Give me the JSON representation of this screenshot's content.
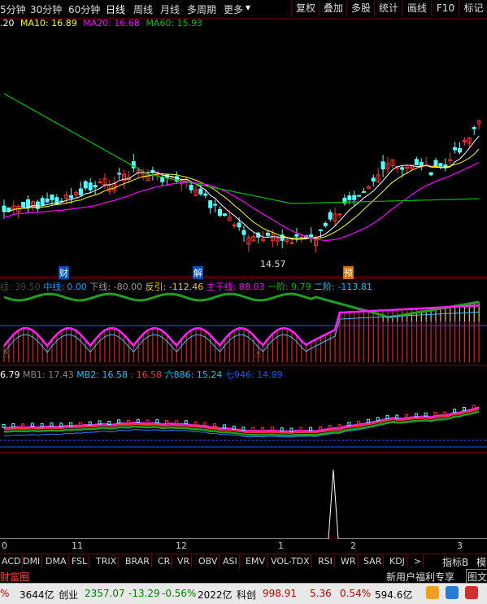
{
  "toolbar": {
    "periods": [
      "5分钟",
      "30分钟",
      "60分钟",
      "日线",
      "周线",
      "月线",
      "多周期",
      "更多"
    ],
    "buttons": [
      "复权",
      "叠加",
      "多股",
      "统计",
      "画线",
      "F10",
      "标记"
    ]
  },
  "ma_legend": {
    "ma5": ".20",
    "ma10": "MA10: 16.89",
    "ma20": "MA20: 16.68",
    "ma60": "MA60: 15.93"
  },
  "markers": {
    "cai": "财",
    "jie": "解",
    "yu": "预",
    "low_price": "14.57"
  },
  "indicator1": {
    "first": "线: 39.50",
    "zhong": "中线: 0.00",
    "xia": "下线: -80.00",
    "fanyin": "反引: -112.46",
    "zhugan": "主干线: 88.03",
    "yijie": "一阶: 9.79",
    "erjie": "二阶: -113.81"
  },
  "indicator2": {
    "v0": "6.79",
    "mb1": "MB1: 17.43",
    "mb2": "MB2: 16.58",
    "v3": ": 16.58",
    "liu": "六886: 15.24",
    "qi": "七946: 14.89"
  },
  "date_labels": [
    "0",
    "11",
    "12",
    "1",
    "2",
    "3"
  ],
  "indicator_tabs": [
    "ACD",
    "DMI",
    "DMA",
    "FSL",
    "TRIX",
    "BRAR",
    "CR",
    "VR",
    "OBV",
    "ASI",
    "EMV",
    "VOL-TDX",
    "RSI",
    "WR",
    "SAR",
    "KDJ",
    ">"
  ],
  "tabs_right": {
    "zhibiao": "指标B",
    "mo": "模"
  },
  "banner": {
    "left": "财富圈",
    "right": "新用户福利专享",
    "tuwen": "图文"
  },
  "status_bar": {
    "s1": "%",
    "s2": "3644亿",
    "s3": "创业",
    "s4": "2357.07",
    "s5": "-13.29",
    "s6": "-0.56%",
    "s7": "2022亿",
    "s8": "科创",
    "s9": "998.91",
    "s10": "5.36",
    "s11": "0.54%",
    "s12": "594.6亿"
  },
  "colors": {
    "up": "#ff3232",
    "down": "#54ffff",
    "ma5": "#ffffff",
    "ma10": "#ffff00",
    "ma20": "#ff00ff",
    "ma60": "#00c000",
    "grid": "#7a0000"
  }
}
